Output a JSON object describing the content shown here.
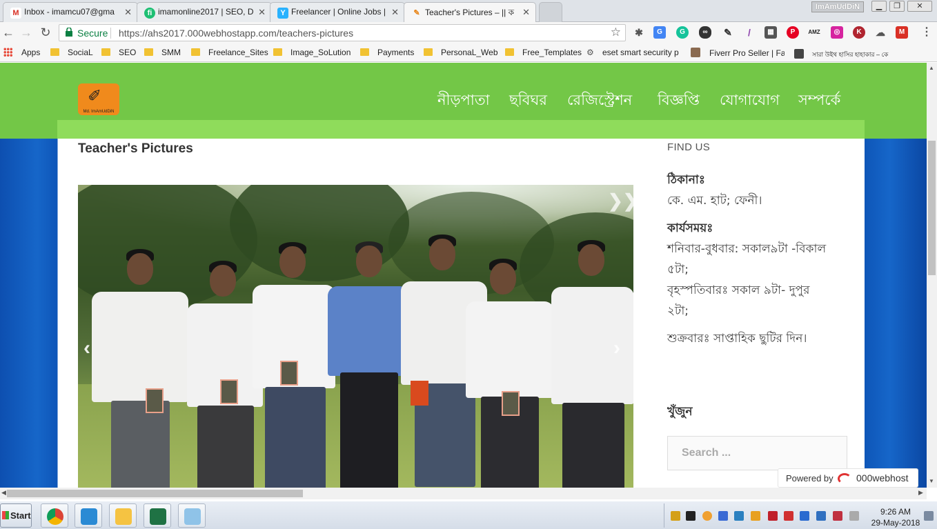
{
  "browser": {
    "tabs": [
      {
        "title": "Inbox - imamcu07@gma",
        "icon": "gmail-icon"
      },
      {
        "title": "imamonline2017 | SEO, D",
        "icon": "fiverr-icon"
      },
      {
        "title": "Freelancer | Online Jobs |",
        "icon": "freelancer-icon"
      },
      {
        "title": "Teacher's Pictures – || ক",
        "icon": "site-icon"
      }
    ],
    "profile_name": "ImAmUdDiN",
    "secure_label": "Secure",
    "url": "https://ahs2017.000webhostapp.com/teachers-pictures",
    "bookmarks": [
      {
        "label": "Apps"
      },
      {
        "label": "SociaL"
      },
      {
        "label": "SEO"
      },
      {
        "label": "SMM"
      },
      {
        "label": "Freelance_Sites"
      },
      {
        "label": "Image_SoLution"
      },
      {
        "label": "Payments"
      },
      {
        "label": "PersonaL_Web"
      },
      {
        "label": "Free_Templates"
      },
      {
        "label": "eset smart security p"
      },
      {
        "label": "Fiverr Pro Seller | Fai"
      },
      {
        "label": "সারা উইথ হাসির হাহাকার – কে"
      }
    ]
  },
  "site": {
    "logo_text": "Md. ImAmUdDiN",
    "menu": [
      "নীড়পাতা",
      "ছবিঘর",
      "রেজিস্ট্রেশন",
      "বিজ্ঞপ্তি",
      "যোগাযোগ",
      "সম্পর্কে"
    ],
    "page_title": "Teacher's Pictures",
    "sidebar": {
      "find_us": "FIND US",
      "address_label": "ঠিকানাঃ",
      "address_value": "কে. এম. হাট; ফেনী।",
      "hours_label": "কার্যসময়ঃ",
      "hours_line1": "শনিবার-বুধবার: সকাল৯টা -বিকাল",
      "hours_line2": "৫টা;",
      "hours_line3": "বৃহস্পতিবারঃ সকাল ৯টা- দুপুর",
      "hours_line4": "২টা;",
      "holiday": "শুক্রবারঃ সাপ্তাহিক ছুটির দিন।",
      "search_heading": "খুঁজুন",
      "search_placeholder": "Search ..."
    },
    "powered_by": "Powered by",
    "host_brand": "000webhost"
  },
  "taskbar": {
    "start_label": "Start",
    "time": "9:26 AM",
    "date": "29-May-2018"
  }
}
